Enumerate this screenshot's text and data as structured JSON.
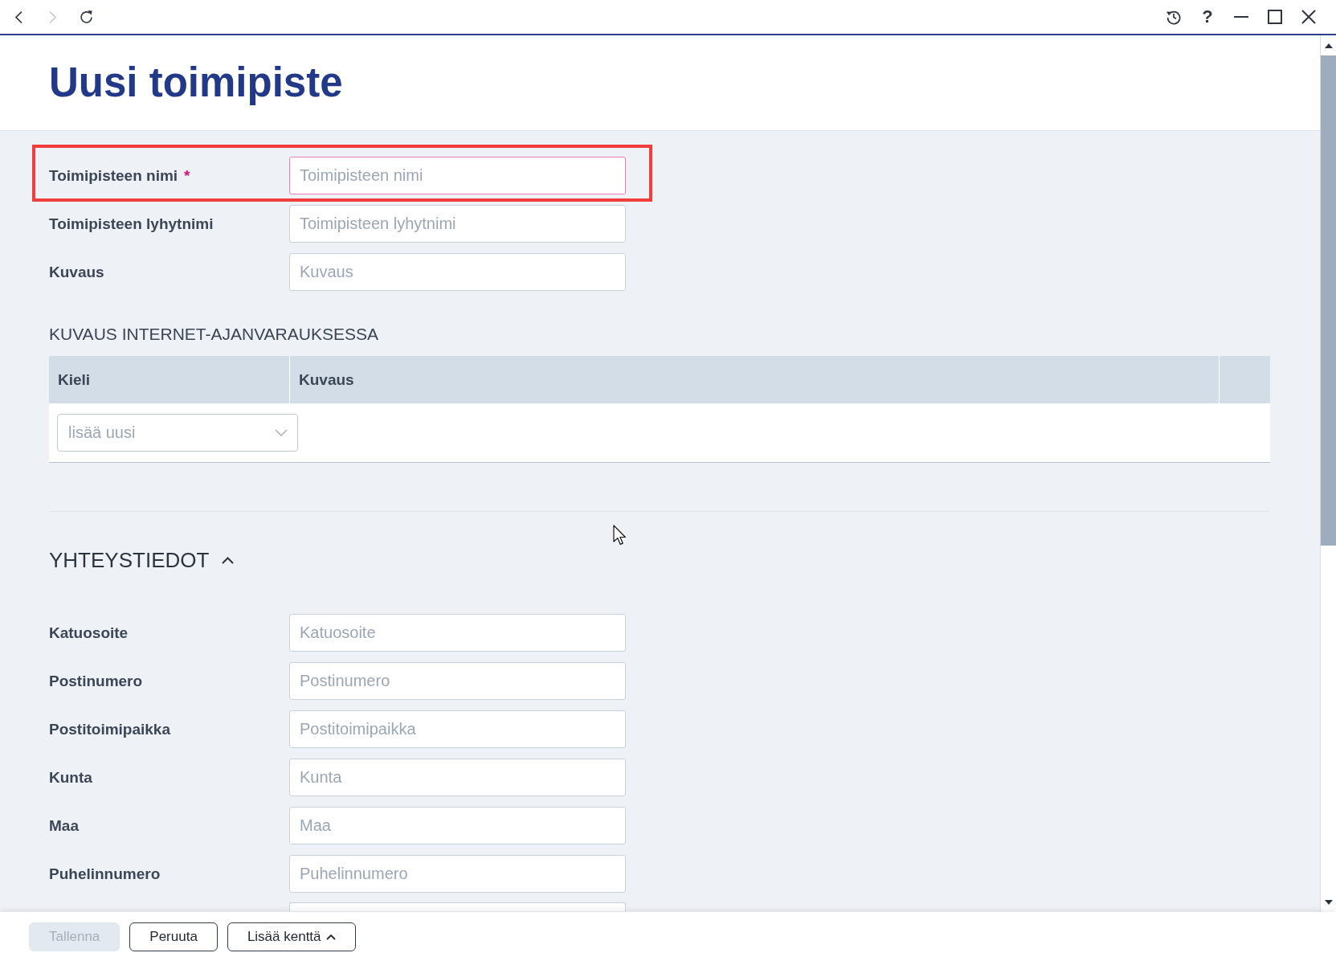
{
  "toolbar": {
    "navigation": [
      {
        "kind": "back",
        "disabled": false
      },
      {
        "kind": "forward",
        "disabled": true
      },
      {
        "kind": "refresh",
        "disabled": false
      }
    ],
    "window_controls": [
      {
        "kind": "history"
      },
      {
        "kind": "help",
        "glyph": "?"
      },
      {
        "kind": "minimize"
      },
      {
        "kind": "maximize"
      },
      {
        "kind": "close"
      }
    ]
  },
  "page": {
    "title": "Uusi toimipiste"
  },
  "basic_fields": [
    {
      "label": "Toimipisteen nimi",
      "required_mark": "*",
      "placeholder": "Toimipisteen nimi",
      "invalid": true,
      "highlighted": true
    },
    {
      "label": "Toimipisteen lyhytnimi",
      "placeholder": "Toimipisteen lyhytnimi",
      "invalid": false,
      "highlighted": false
    },
    {
      "label": "Kuvaus",
      "placeholder": "Kuvaus",
      "invalid": false,
      "highlighted": false
    }
  ],
  "online_description": {
    "heading": "KUVAUS INTERNET-AJANVARAUKSESSA",
    "table": {
      "columns": [
        "Kieli",
        "Kuvaus"
      ],
      "add_row": {
        "placeholder": "lisää uusi"
      }
    }
  },
  "contact_section": {
    "heading": "YHTEYSTIEDOT",
    "expanded": true,
    "fields": [
      {
        "label": "Katuosoite",
        "placeholder": "Katuosoite"
      },
      {
        "label": "Postinumero",
        "placeholder": "Postinumero"
      },
      {
        "label": "Postitoimipaikka",
        "placeholder": "Postitoimipaikka"
      },
      {
        "label": "Kunta",
        "placeholder": "Kunta"
      },
      {
        "label": "Maa",
        "placeholder": "Maa"
      },
      {
        "label": "Puhelinnumero",
        "placeholder": "Puhelinnumero"
      }
    ],
    "more_fields_below": true
  },
  "footer": {
    "buttons": [
      {
        "label": "Tallenna",
        "disabled": true,
        "has_menu": false
      },
      {
        "label": "Peruuta",
        "disabled": false,
        "has_menu": false
      },
      {
        "label": "Lisää kenttä",
        "disabled": false,
        "has_menu": true
      }
    ]
  }
}
